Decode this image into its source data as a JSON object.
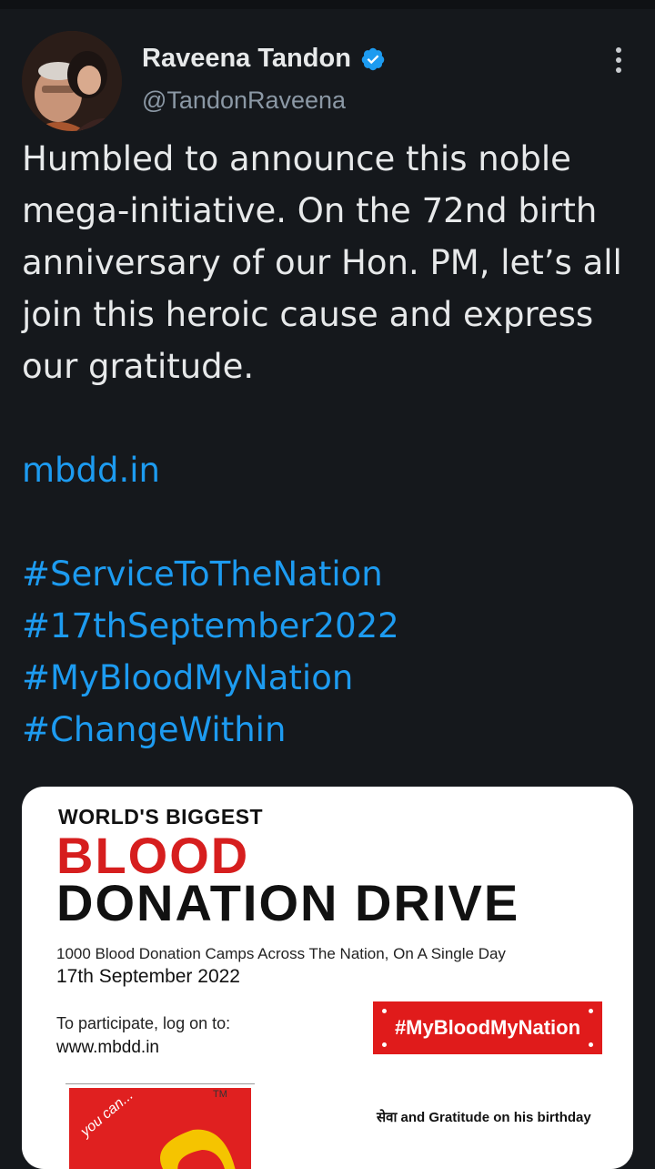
{
  "author": {
    "name": "Raveena Tandon",
    "handle": "@TandonRaveena",
    "verified_icon": "verified-badge-icon",
    "accent_color": "#1d9bf0"
  },
  "tweet": {
    "text": "Humbled to announce this noble mega-initiative. On the 72nd birth anniversary of our Hon. PM, let’s all join this heroic cause and express our gratitude.",
    "link": "mbdd.in",
    "hashtags": [
      "#ServiceToTheNation",
      "#17thSeptember2022",
      "#MyBloodMyNation",
      "#ChangeWithin"
    ]
  },
  "card": {
    "line1": "WORLD'S BIGGEST",
    "line2": "BLOOD",
    "line3": "DONATION DRIVE",
    "subtitle": "1000 Blood Donation Camps Across The Nation, On A Single Day",
    "date": "17th September 2022",
    "participate": "To participate, log on to:",
    "url": "www.mbdd.in",
    "tag": "#MyBloodMyNation",
    "logo_text": "you can...",
    "tm": "TM",
    "footer": "सेवा and Gratitude on his birthday"
  }
}
